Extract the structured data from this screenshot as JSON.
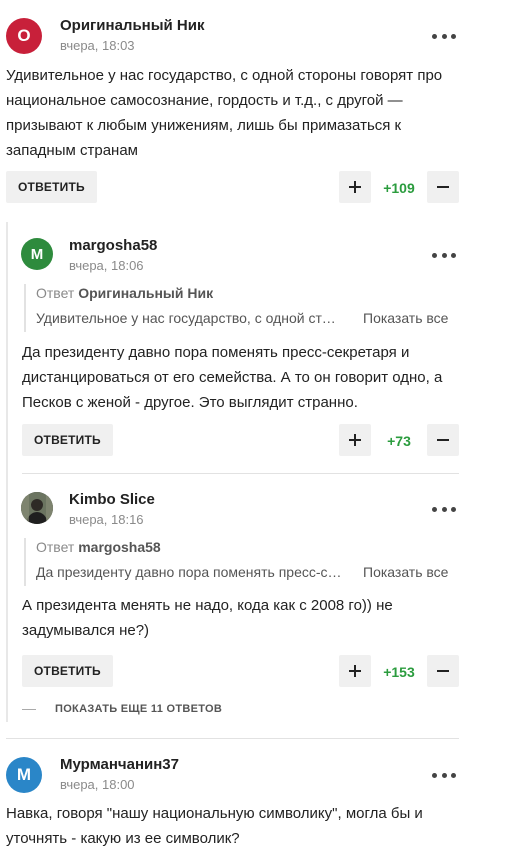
{
  "ui": {
    "reply_label": "ОТВЕТИТЬ",
    "reply_prefix": "Ответ",
    "show_all_label": "Показать все",
    "more_replies_label": "ПОКАЗАТЬ ЕЩЕ 11 ОТВЕТОВ"
  },
  "colors": {
    "score_positive": "#2b9c3e",
    "avatar_red": "#c8203a",
    "avatar_green": "#2e8b3d",
    "avatar_blue": "#2a86c8"
  },
  "comments": [
    {
      "avatar_letter": "О",
      "author": "Оригинальный Ник",
      "time": "вчера, 18:03",
      "text": "Удивительное у нас государство, с одной стороны говорят про национальное самосознание, гордость и т.д., с другой — призывают к любым унижениям, лишь бы примазаться к западным странам",
      "score": "+109"
    },
    {
      "avatar_letter": "M",
      "author": "margosha58",
      "time": "вчера, 18:06",
      "reply_to": "Оригинальный Ник",
      "quote_excerpt": "Удивительное у нас государство, с одной сто…",
      "text": "Да президенту давно пора поменять пресс-секретаря и дистанцироваться от его семейства. А то он говорит одно, а Песков с женой - другое. Это выглядит странно.",
      "score": "+73"
    },
    {
      "avatar_letter": "",
      "author": "Kimbo Slice",
      "time": "вчера, 18:16",
      "reply_to": "margosha58",
      "quote_excerpt": "Да президенту давно пора поменять пресс-с…",
      "text": "А президента менять не надо, кода как с 2008 го)) не задумывался не?)",
      "score": "+153"
    },
    {
      "avatar_letter": "М",
      "author": "Мурманчанин37",
      "time": "вчера, 18:00",
      "text": "Навка, говоря \"нашу национальную символику\", могла бы и уточнять - какую из ее символик?"
    }
  ]
}
